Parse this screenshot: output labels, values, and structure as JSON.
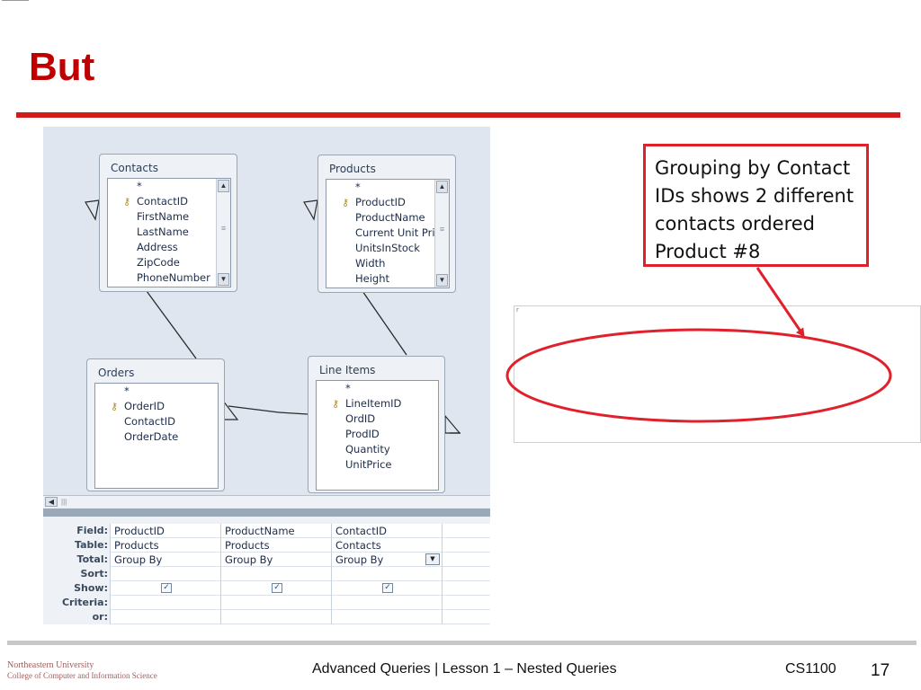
{
  "slide": {
    "title": "But",
    "callout_text": "Grouping by Contact IDs shows 2 different contacts ordered Product #8"
  },
  "colors": {
    "title": "#c00000",
    "accent_rule": "#d11a1a",
    "callout_border": "#e0202a"
  },
  "designer": {
    "tables": [
      {
        "title": "Contacts",
        "fields": [
          {
            "name": "*",
            "key": false
          },
          {
            "name": "ContactID",
            "key": true
          },
          {
            "name": "FirstName",
            "key": false
          },
          {
            "name": "LastName",
            "key": false
          },
          {
            "name": "Address",
            "key": false
          },
          {
            "name": "ZipCode",
            "key": false
          },
          {
            "name": "PhoneNumber",
            "key": false
          }
        ]
      },
      {
        "title": "Products",
        "fields": [
          {
            "name": "*",
            "key": false
          },
          {
            "name": "ProductID",
            "key": true
          },
          {
            "name": "ProductName",
            "key": false
          },
          {
            "name": "Current Unit Pri",
            "key": false
          },
          {
            "name": "UnitsInStock",
            "key": false
          },
          {
            "name": "Width",
            "key": false
          },
          {
            "name": "Height",
            "key": false
          }
        ]
      },
      {
        "title": "Orders",
        "fields": [
          {
            "name": "*",
            "key": false
          },
          {
            "name": "OrderID",
            "key": true
          },
          {
            "name": "ContactID",
            "key": false
          },
          {
            "name": "OrderDate",
            "key": false
          }
        ]
      },
      {
        "title": "Line Items",
        "fields": [
          {
            "name": "*",
            "key": false
          },
          {
            "name": "LineItemID",
            "key": true
          },
          {
            "name": "OrdID",
            "key": false
          },
          {
            "name": "ProdID",
            "key": false
          },
          {
            "name": "Quantity",
            "key": false
          },
          {
            "name": "UnitPrice",
            "key": false
          }
        ]
      }
    ],
    "grid_row_labels": [
      "Field:",
      "Table:",
      "Total:",
      "Sort:",
      "Show:",
      "Criteria:",
      "or:"
    ],
    "grid_columns": [
      {
        "field": "ProductID",
        "table": "Products",
        "total": "Group By",
        "show": true
      },
      {
        "field": "ProductName",
        "table": "Products",
        "total": "Group By",
        "show": true
      },
      {
        "field": "ContactID",
        "table": "Contacts",
        "total": "Group By",
        "show": true
      }
    ],
    "key_icon": "key-icon",
    "checkbox_glyph": "✓",
    "dropdown_glyph": "▼"
  },
  "footer": {
    "university": "Northeastern University",
    "college": "College of Computer and Information Science",
    "center": "Advanced Queries | Lesson 1 – Nested Queries",
    "course": "CS1100",
    "page": "17"
  }
}
